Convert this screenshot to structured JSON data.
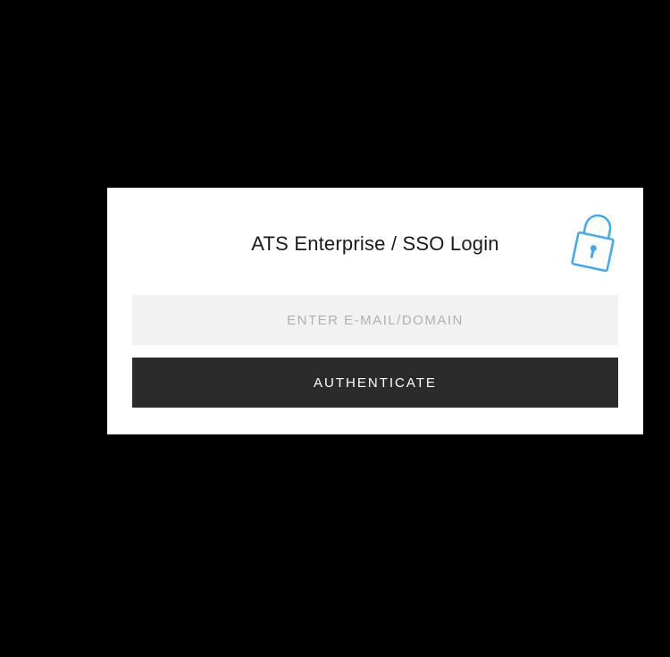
{
  "login": {
    "title": "ATS Enterprise / SSO Login",
    "email_placeholder": "ENTER E-MAIL/DOMAIN",
    "auth_button_label": "AUTHENTICATE"
  },
  "colors": {
    "accent": "#3FA9F5",
    "button_bg": "#2b2b2b",
    "input_bg": "#f2f2f2"
  }
}
